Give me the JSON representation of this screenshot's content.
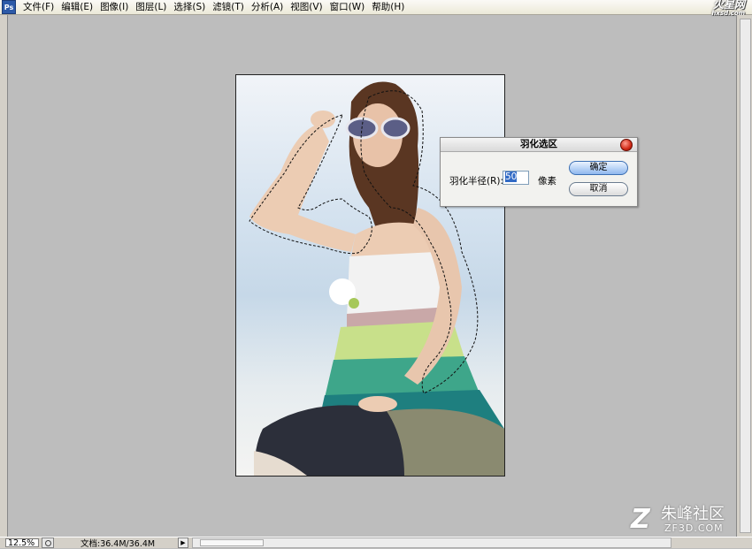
{
  "menubar": {
    "app_icon": "Ps",
    "items": [
      "文件(F)",
      "编辑(E)",
      "图像(I)",
      "图层(L)",
      "选择(S)",
      "滤镜(T)",
      "分析(A)",
      "视图(V)",
      "窗口(W)",
      "帮助(H)"
    ],
    "brand_logo": "火星网",
    "brand_sub": "hxsd.com"
  },
  "dialog": {
    "title": "羽化选区",
    "feather_label": "羽化半径(R):",
    "feather_value": "50",
    "unit": "像素",
    "ok_label": "确定",
    "cancel_label": "取消"
  },
  "statusbar": {
    "zoom": "12.5%",
    "doc_info": "文档:36.4M/36.4M",
    "arrow": "▶"
  },
  "watermark": {
    "mark": "Z",
    "text": "朱峰社区",
    "url": "ZF3D.COM"
  },
  "colors": {
    "workspace": "#bdbdbd",
    "ok_button": "#8fb8ee",
    "close_button": "#d02a17"
  }
}
